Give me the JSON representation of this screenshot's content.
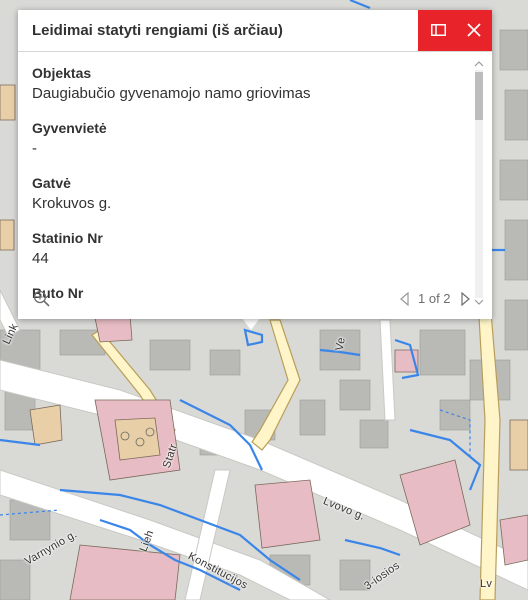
{
  "popup": {
    "title": "Leidimai statyti rengiami (iš arčiau)",
    "fields": [
      {
        "label": "Objektas",
        "value": "Daugiabučio gyvenamojo namo griovimas"
      },
      {
        "label": "Gyvenvietė",
        "value": "-"
      },
      {
        "label": "Gatvė",
        "value": "Krokuvos g."
      },
      {
        "label": "Statinio Nr",
        "value": "44"
      },
      {
        "label": "Buto Nr",
        "value": ""
      }
    ],
    "pager": {
      "text": "1 of 2",
      "current": 1,
      "total": 2
    },
    "icons": {
      "dock": "dock-icon",
      "close": "close-icon",
      "zoom": "zoom-to-icon",
      "prev": "chevron-left-icon",
      "next": "chevron-right-icon"
    }
  },
  "map": {
    "street_labels": [
      "Lvovo g.",
      "Konstitucijos",
      "Lieh",
      "Link",
      "Ve",
      "Statr",
      "3-iosios",
      "Varnynio g.",
      "Lv"
    ],
    "colors": {
      "background": "#d9d9d6",
      "road": "#ffffff",
      "road_outline": "#b89e5a",
      "road_fill_yellow": "#fff5c8",
      "building": "#b9b9b6",
      "building_pink": "#e8bcc4",
      "building_tan": "#e8cfa8",
      "highlight_blue": "#3a86e8",
      "accent_red": "#e8232a"
    }
  }
}
